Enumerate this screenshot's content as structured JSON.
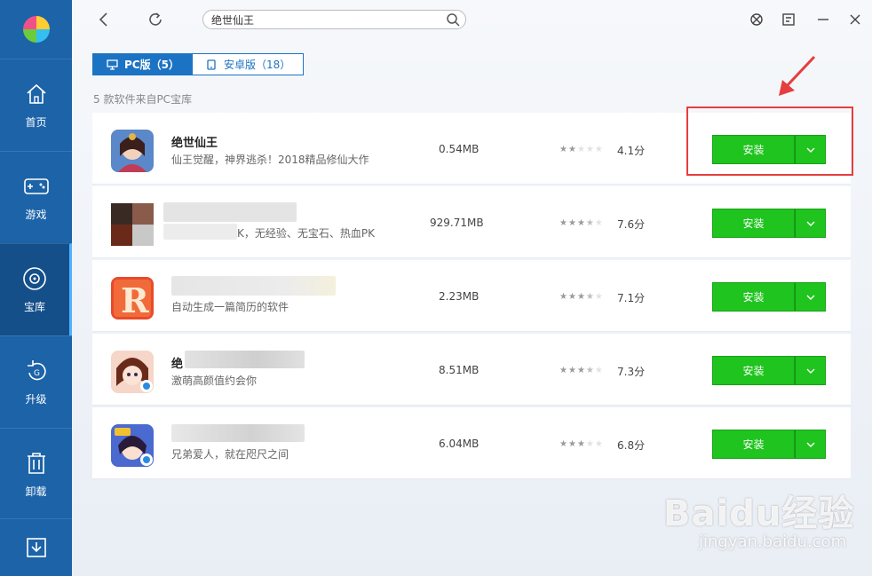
{
  "sidebar": {
    "items": [
      {
        "label": "首页",
        "icon": "home-icon"
      },
      {
        "label": "游戏",
        "icon": "gamepad-icon"
      },
      {
        "label": "宝库",
        "icon": "disc-icon"
      },
      {
        "label": "升级",
        "icon": "upgrade-icon"
      },
      {
        "label": "卸载",
        "icon": "trash-icon"
      }
    ]
  },
  "search": {
    "value": "绝世仙王"
  },
  "tabs": [
    {
      "label": "PC版（5）"
    },
    {
      "label": "安卓版（18）"
    }
  ],
  "source_note": "5 款软件来自PC宝库",
  "apps": [
    {
      "name": "绝世仙王",
      "desc": "仙王觉醒，神界逃杀！2018精品修仙大作",
      "size": "0.54MB",
      "rating": 2,
      "score": "4.1分",
      "install_label": "安装"
    },
    {
      "name": "",
      "desc": "K，无经验、无宝石、热血PK",
      "size": "929.71MB",
      "rating": 3.5,
      "score": "7.6分",
      "install_label": "安装"
    },
    {
      "name": "",
      "desc": "自动生成一篇简历的软件",
      "size": "2.23MB",
      "rating": 3.5,
      "score": "7.1分",
      "install_label": "安装"
    },
    {
      "name": "绝",
      "desc": "激萌高颜值约会你",
      "size": "8.51MB",
      "rating": 3.5,
      "score": "7.3分",
      "install_label": "安装"
    },
    {
      "name": "",
      "desc": "兄弟爱人，就在咫尺之间",
      "size": "6.04MB",
      "rating": 3,
      "score": "6.8分",
      "install_label": "安装"
    }
  ],
  "watermark": {
    "main": "Baidu经验",
    "sub": "jingyan.baidu.com"
  },
  "colors": {
    "sidebar": "#1c63a8",
    "accent": "#1c73c4",
    "install": "#1fc41e",
    "highlight": "#e53e3e"
  }
}
